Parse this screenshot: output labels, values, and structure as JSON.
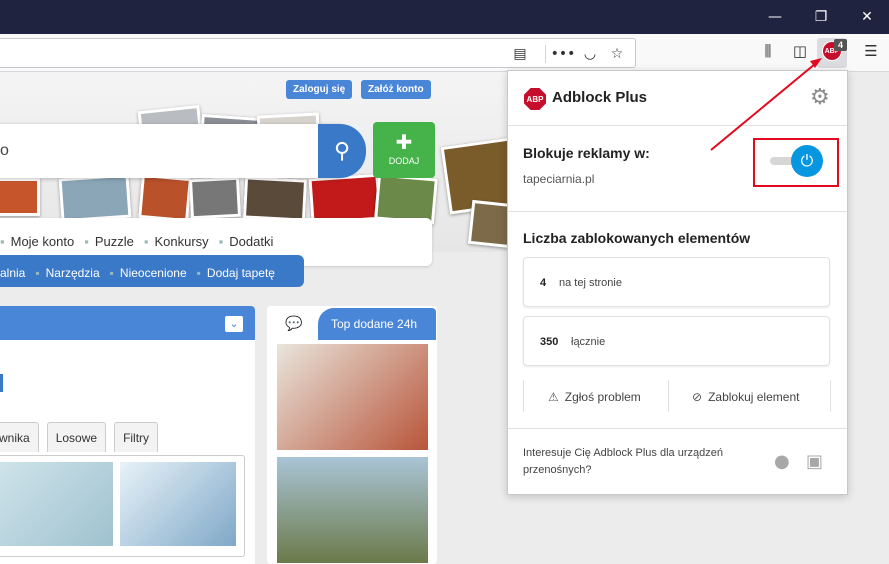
{
  "window": {
    "minimize_icon": "—",
    "maximize_icon": "❐",
    "close_icon": "✕"
  },
  "toolbar": {
    "abp_badge": "4",
    "abp_icon_text": "ABP"
  },
  "site": {
    "login_label": "Zaloguj się",
    "register_label": "Załóż konto",
    "search_query": "o",
    "add_label": "DODAJ",
    "nav_row1": [
      "Moje konto",
      "Puzzle",
      "Konkursy",
      "Dodatki"
    ],
    "nav_row2": [
      "alnia",
      "Narzędzia",
      "Nieocenione",
      "Dodaj tapetę"
    ],
    "tabs": [
      "wnika",
      "Losowe",
      "Filtry"
    ],
    "top_panel_title": "Top dodane 24h"
  },
  "popup": {
    "logo_text": "ABP",
    "title": "Adblock Plus",
    "block_label": "Blokuje reklamy w:",
    "domain": "tapeciarnia.pl",
    "toggle_on": true,
    "count_title": "Liczba zablokowanych elementów",
    "stats": [
      {
        "value": "4",
        "label": "na tej stronie"
      },
      {
        "value": "350",
        "label": "łącznie"
      }
    ],
    "report_label": "Zgłoś problem",
    "block_element_label": "Zablokuj element",
    "mobile_text": "Interesuje Cię Adblock Plus dla urządzeń przenośnych?"
  },
  "colors": {
    "titlebar": "#202340",
    "abp_red": "#c70d2c",
    "toggle_blue": "#0797e1",
    "highlight_red": "#e3091e",
    "site_blue": "#4a86d8"
  }
}
